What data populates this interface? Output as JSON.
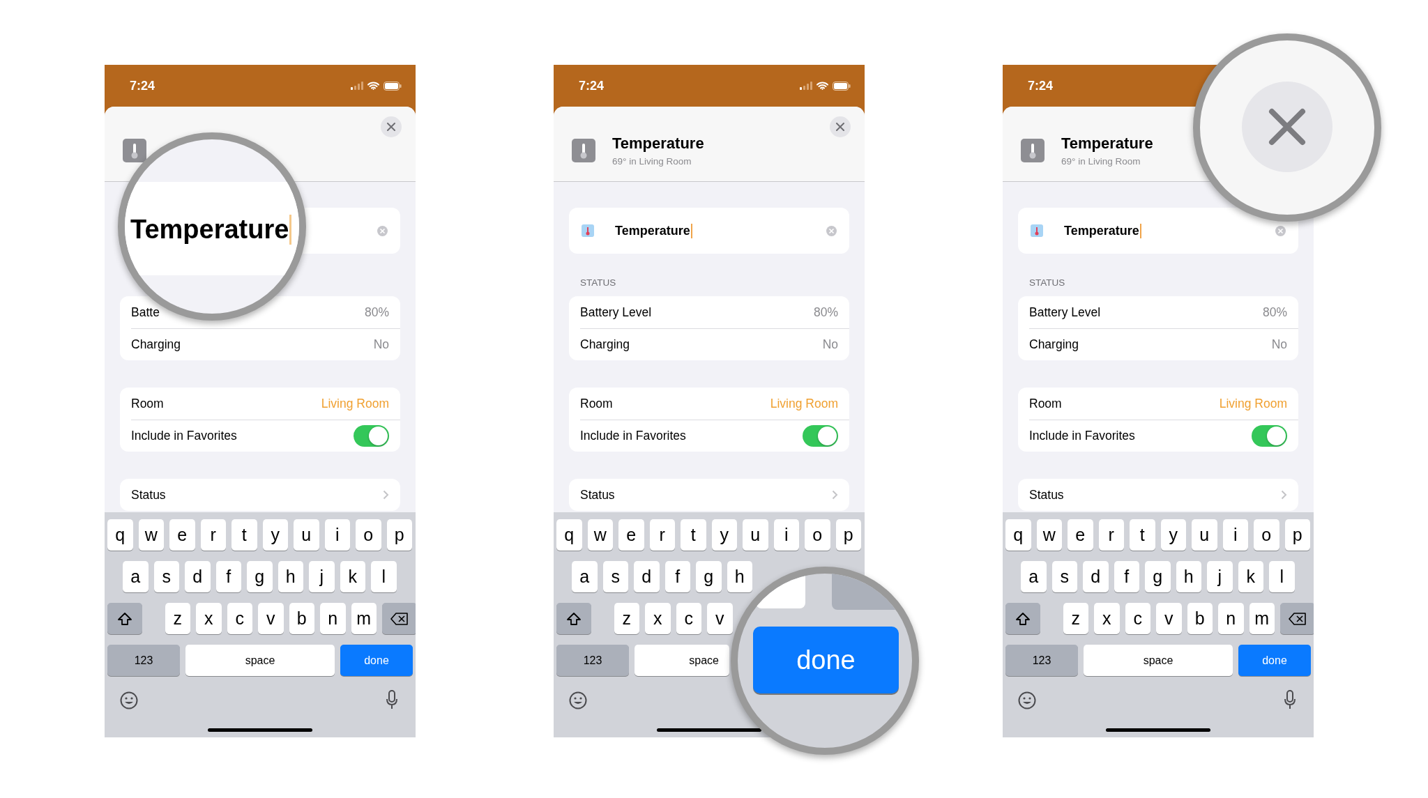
{
  "phones": [
    {
      "time": "7:24",
      "sections": [
        {
          "rows": [
            {
              "kind": "value",
              "label": "Batte",
              "value": "80%"
            },
            {
              "kind": "value",
              "label": "Charging",
              "value": "No"
            }
          ]
        },
        {
          "rows": [
            {
              "kind": "link",
              "label": "Room",
              "value": "Living Room"
            },
            {
              "kind": "toggle",
              "label": "Include in Favorites",
              "on": true
            }
          ]
        },
        {
          "rows": [
            {
              "kind": "nav",
              "label": "Status"
            }
          ]
        }
      ],
      "keyboard": {
        "row1": [
          "q",
          "w",
          "e",
          "r",
          "t",
          "y",
          "u",
          "i",
          "o",
          "p"
        ],
        "row2": [
          "a",
          "s",
          "d",
          "f",
          "g",
          "h",
          "j",
          "k",
          "l"
        ],
        "row3": [
          "z",
          "x",
          "c",
          "v",
          "b",
          "n",
          "m"
        ],
        "shift": true,
        "backspace": true,
        "bottom": [
          {
            "kind": "numbers",
            "label": "123"
          },
          {
            "kind": "space",
            "label": "space"
          },
          {
            "kind": "done",
            "label": "done"
          }
        ]
      },
      "magnifier": {
        "kind": "name-field",
        "text": "Temperature"
      }
    },
    {
      "time": "7:24",
      "header": {
        "title": "Temperature",
        "subtitle": "69° in Living Room"
      },
      "field": {
        "value": "Temperature"
      },
      "status_label": "STATUS",
      "sections": [
        {
          "rows": [
            {
              "kind": "value",
              "label": "Battery Level",
              "value": "80%"
            },
            {
              "kind": "value",
              "label": "Charging",
              "value": "No"
            }
          ]
        },
        {
          "rows": [
            {
              "kind": "link",
              "label": "Room",
              "value": "Living Room"
            },
            {
              "kind": "toggle",
              "label": "Include in Favorites",
              "on": true
            }
          ]
        },
        {
          "rows": [
            {
              "kind": "nav",
              "label": "Status"
            }
          ]
        }
      ],
      "keyboard": {
        "row1": [
          "q",
          "w",
          "e",
          "r",
          "t",
          "y",
          "u",
          "i",
          "o",
          "p"
        ],
        "row2": [
          "a",
          "s",
          "d",
          "f",
          "g",
          "h"
        ],
        "row3": [
          "z",
          "x",
          "c",
          "v"
        ],
        "shift": true,
        "backspace": false,
        "bottom": [
          {
            "kind": "numbers",
            "label": "123"
          },
          {
            "kind": "space",
            "label": "space"
          }
        ]
      },
      "magnifier": {
        "kind": "done-key",
        "text": "done"
      }
    },
    {
      "time": "7:24",
      "header": {
        "title": "Temperature",
        "subtitle": "69° in Living Room"
      },
      "field": {
        "value": "Temperature"
      },
      "status_label": "STATUS",
      "sections": [
        {
          "rows": [
            {
              "kind": "value",
              "label": "Battery Level",
              "value": "80%"
            },
            {
              "kind": "value",
              "label": "Charging",
              "value": "No"
            }
          ]
        },
        {
          "rows": [
            {
              "kind": "link",
              "label": "Room",
              "value": "Living Room"
            },
            {
              "kind": "toggle",
              "label": "Include in Favorites",
              "on": true
            }
          ]
        },
        {
          "rows": [
            {
              "kind": "nav",
              "label": "Status"
            }
          ]
        }
      ],
      "keyboard": {
        "row1": [
          "q",
          "w",
          "e",
          "r",
          "t",
          "y",
          "u",
          "i",
          "o",
          "p"
        ],
        "row2": [
          "a",
          "s",
          "d",
          "f",
          "g",
          "h",
          "j",
          "k",
          "l"
        ],
        "row3": [
          "z",
          "x",
          "c",
          "v",
          "b",
          "n",
          "m"
        ],
        "shift": true,
        "backspace": true,
        "bottom": [
          {
            "kind": "numbers",
            "label": "123"
          },
          {
            "kind": "space",
            "label": "space"
          },
          {
            "kind": "done",
            "label": "done"
          }
        ]
      },
      "magnifier": {
        "kind": "close-button"
      }
    }
  ]
}
